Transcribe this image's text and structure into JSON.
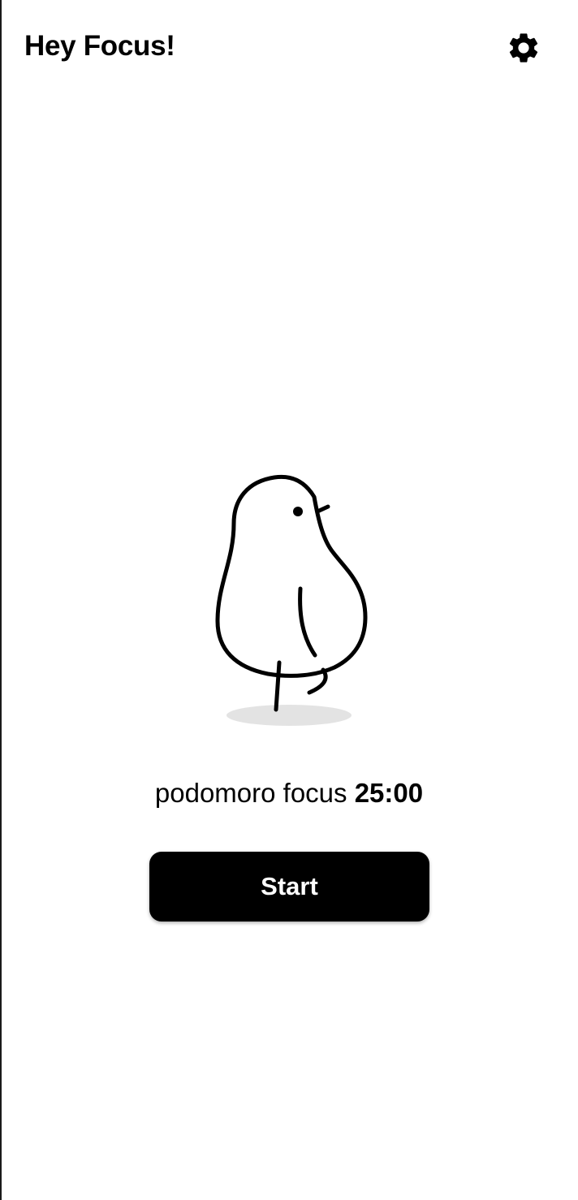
{
  "app_bar": {
    "title": "Hey Focus!",
    "settings_icon": "gear-icon"
  },
  "main": {
    "illustration": "chick-mascot",
    "timer_label": "podomoro focus",
    "timer_value": "25:00",
    "start_label": "Start"
  },
  "colors": {
    "background": "#ffffff",
    "text": "#000000",
    "button": "#000000",
    "button_text": "#ffffff",
    "shadow": "#e3e3e3"
  }
}
